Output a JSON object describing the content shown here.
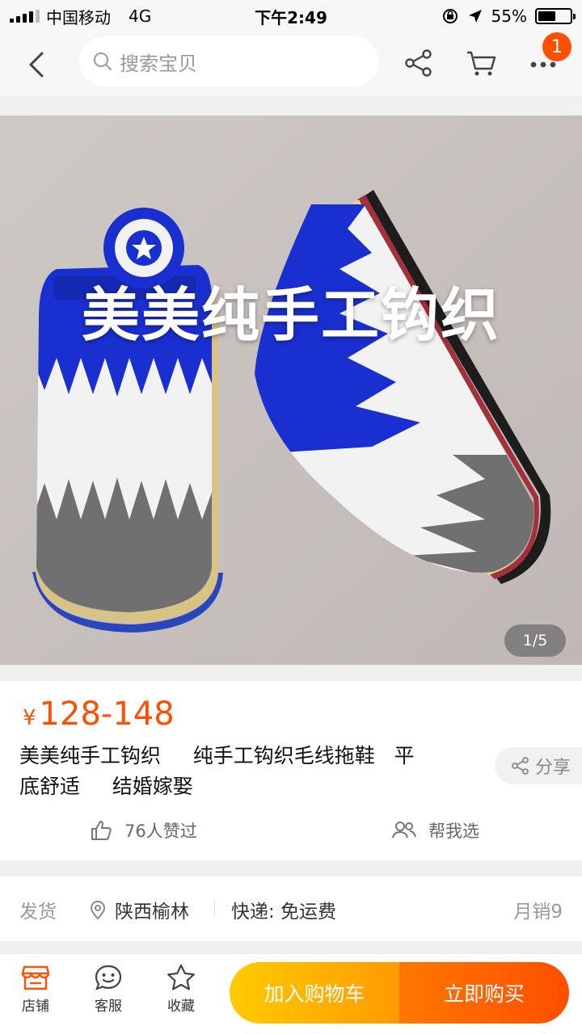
{
  "status_bar": {
    "carrier": "中国移动",
    "network": "4G",
    "time": "下午2:49",
    "battery": "55%",
    "battery_level": 0.55
  },
  "nav": {
    "search_placeholder": "搜索宝贝",
    "badge_count": "1"
  },
  "hero": {
    "overlay_text": "美美纯手工钩织",
    "counter": "1/5",
    "colors": {
      "blue": "#1a2fd0",
      "white": "#f4f4f4",
      "gray": "#707070",
      "sole_red": "#a3303a",
      "sole_yellow": "#e8d28a"
    }
  },
  "product": {
    "currency": "¥",
    "price": "128-148",
    "title_line1": "美美纯手工钩织     纯手工钩织毛线拖鞋   平",
    "title_line2": "底舒适     结婚嫁娶",
    "share_label": "分享",
    "likes_label": "76人赞过",
    "help_label": "帮我选"
  },
  "shipping": {
    "label": "发货",
    "location": "陕西榆林",
    "express": "快递: 免运费",
    "monthly_sales": "月销9"
  },
  "bottom_bar": {
    "store_label": "店铺",
    "service_label": "客服",
    "favorite_label": "收藏",
    "add_cart_label": "加入购物车",
    "buy_now_label": "立即购买"
  },
  "colors": {
    "accent": "#ff5000",
    "cart_button": "#ffaa00",
    "buy_button": "#ff5a00"
  }
}
